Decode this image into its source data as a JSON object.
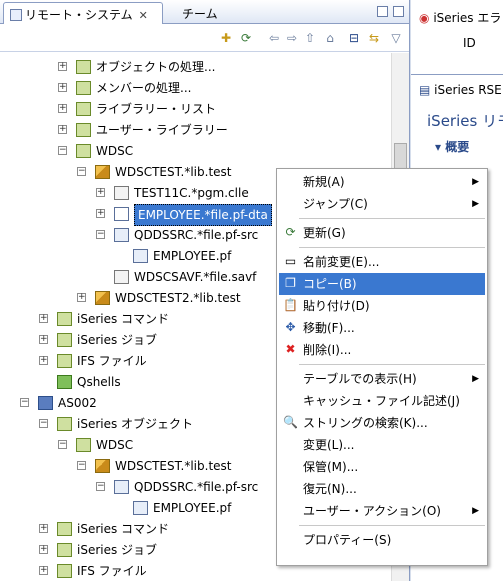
{
  "left": {
    "tab_active": "リモート・システム",
    "tab_close": "✕",
    "tab_inactive": "チーム"
  },
  "tree": [
    {
      "label": "オブジェクトの処理...",
      "toggle": "+",
      "icon": "gen"
    },
    {
      "label": "メンバーの処理...",
      "toggle": "+",
      "icon": "gen"
    },
    {
      "label": "ライブラリー・リスト",
      "toggle": "+",
      "icon": "gen"
    },
    {
      "label": "ユーザー・ライブラリー",
      "toggle": "+",
      "icon": "gen"
    },
    {
      "label": "WDSC",
      "toggle": "−",
      "icon": "gen"
    },
    {
      "label": "WDSCTEST.*lib.test",
      "toggle": "−",
      "icon": "lib"
    },
    {
      "label": "TEST11C.*pgm.clle",
      "toggle": "+",
      "icon": "obj"
    },
    {
      "label": "EMPLOYEE.*file.pf-dta",
      "toggle": "+",
      "icon": "pf",
      "selected": true
    },
    {
      "label": "QDDSSRC.*file.pf-src",
      "toggle": "−",
      "icon": "src"
    },
    {
      "label": "EMPLOYEE.pf",
      "toggle": "",
      "icon": "src"
    },
    {
      "label": "WDSCSAVF.*file.savf",
      "toggle": "",
      "icon": "obj"
    },
    {
      "label": "WDSCTEST2.*lib.test",
      "toggle": "+",
      "icon": "lib"
    },
    {
      "label": "iSeries コマンド",
      "toggle": "+",
      "icon": "gen"
    },
    {
      "label": "iSeries ジョブ",
      "toggle": "+",
      "icon": "gen"
    },
    {
      "label": "IFS ファイル",
      "toggle": "+",
      "icon": "gen"
    },
    {
      "label": "Qshells",
      "toggle": "",
      "icon": "green"
    },
    {
      "label": "AS002",
      "toggle": "−",
      "icon": "sys"
    },
    {
      "label": "iSeries オブジェクト",
      "toggle": "−",
      "icon": "gen"
    },
    {
      "label": "WDSC",
      "toggle": "−",
      "icon": "gen"
    },
    {
      "label": "WDSCTEST.*lib.test",
      "toggle": "−",
      "icon": "lib"
    },
    {
      "label": "QDDSSRC.*file.pf-src",
      "toggle": "−",
      "icon": "src"
    },
    {
      "label": "EMPLOYEE.pf",
      "toggle": "",
      "icon": "src"
    },
    {
      "label": "iSeries コマンド",
      "toggle": "+",
      "icon": "gen"
    },
    {
      "label": "iSeries ジョブ",
      "toggle": "+",
      "icon": "gen"
    },
    {
      "label": "IFS ファイル",
      "toggle": "+",
      "icon": "gen"
    }
  ],
  "right": {
    "tab1": "iSeries エラ",
    "col_id": "ID",
    "tab2": "iSeries RSE",
    "title": "iSeries リモ",
    "section": "概要"
  },
  "menu": [
    {
      "label": "新規(A)",
      "submenu": true,
      "icon": ""
    },
    {
      "label": "ジャンプ(C)",
      "submenu": true,
      "icon": ""
    },
    {
      "sep": true
    },
    {
      "label": "更新(G)",
      "icon": "refresh-icon",
      "glyph": "⟳"
    },
    {
      "sep": true
    },
    {
      "label": "名前変更(E)...",
      "icon": "rename-icon",
      "glyph": "▭"
    },
    {
      "label": "コピー(B)",
      "icon": "copy-icon",
      "glyph": "❐",
      "highlight": true
    },
    {
      "label": "貼り付け(D)",
      "icon": "paste-icon",
      "glyph": "📋"
    },
    {
      "label": "移動(F)...",
      "icon": "move-icon",
      "glyph": "✥"
    },
    {
      "label": "削除(I)...",
      "icon": "delete-icon",
      "glyph": "✖"
    },
    {
      "sep": true
    },
    {
      "label": "テーブルでの表示(H)",
      "submenu": true,
      "icon": ""
    },
    {
      "label": "キャッシュ・ファイル記述(J)",
      "icon": ""
    },
    {
      "label": "ストリングの検索(K)...",
      "icon": "search-string-icon",
      "glyph": "🔍"
    },
    {
      "label": "変更(L)...",
      "icon": ""
    },
    {
      "label": "保管(M)...",
      "icon": ""
    },
    {
      "label": "復元(N)...",
      "icon": ""
    },
    {
      "label": "ユーザー・アクション(O)",
      "submenu": true,
      "icon": ""
    },
    {
      "sep": true
    },
    {
      "label": "プロパティー(S)",
      "icon": ""
    }
  ],
  "colors": {
    "selection": "#3a78d0",
    "accent": "#8b9dc3"
  }
}
